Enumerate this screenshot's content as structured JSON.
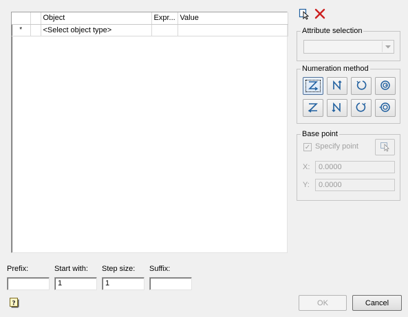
{
  "grid": {
    "columns": [
      "",
      "",
      "Object",
      "Expr...",
      "Value"
    ],
    "rows": [
      {
        "indicator": "*",
        "object": "<Select object type>",
        "expr": "",
        "value": ""
      }
    ]
  },
  "top_icons": [
    "select-object-icon",
    "delete-icon"
  ],
  "attribute_selection": {
    "label": "Attribute selection",
    "selected": ""
  },
  "numeration_method": {
    "label": "Numeration method",
    "buttons": [
      "z-rows-icon",
      "n-columns-icon",
      "spiral-ccw-icon",
      "spiral-inward-icon",
      "z-rows-reverse-icon",
      "n-columns-reverse-icon",
      "spiral-cw-icon",
      "spiral-outward-icon"
    ],
    "selected_index": 0
  },
  "base_point": {
    "label": "Base point",
    "specify_label": "Specify point",
    "specify_checked": true,
    "x_label": "X:",
    "x_value": "0.0000",
    "y_label": "Y:",
    "y_value": "0.0000"
  },
  "fields": {
    "prefix_label": "Prefix:",
    "prefix_value": "",
    "start_label": "Start with:",
    "start_value": "1",
    "step_label": "Step size:",
    "step_value": "1",
    "suffix_label": "Suffix:",
    "suffix_value": ""
  },
  "buttons": {
    "ok": "OK",
    "cancel": "Cancel"
  },
  "colors": {
    "icon_blue": "#1f5f9f",
    "delete_red": "#cc1f1f"
  }
}
